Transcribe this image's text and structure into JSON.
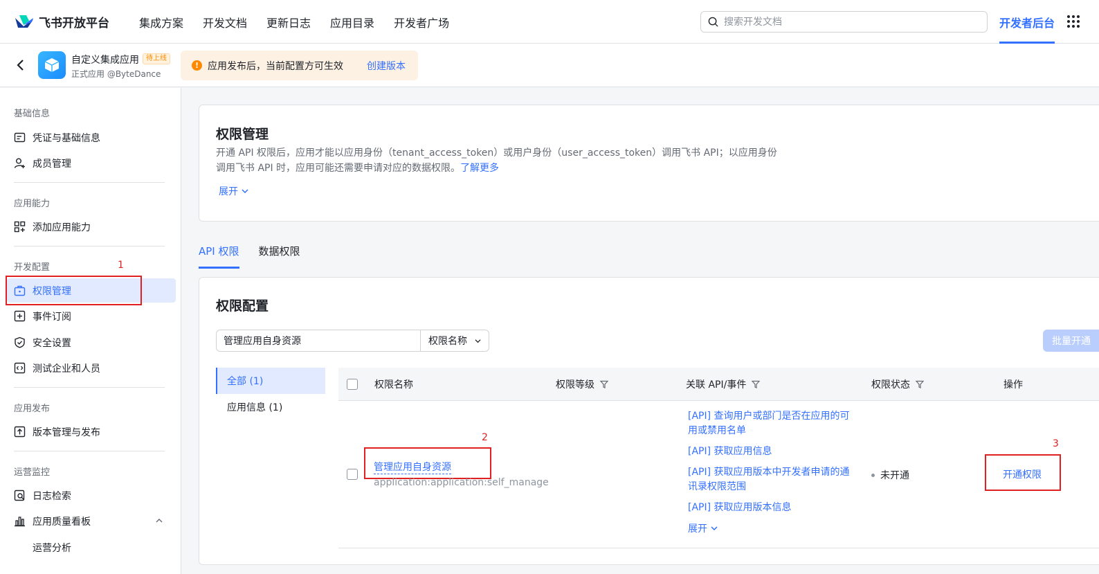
{
  "brand": {
    "name": "飞书开放平台"
  },
  "nav": {
    "items": [
      "集成方案",
      "开发文档",
      "更新日志",
      "应用目录",
      "开发者广场"
    ],
    "dev_console": "开发者后台"
  },
  "search": {
    "placeholder": "搜索开发文档"
  },
  "app": {
    "name": "自定义集成应用",
    "badge": "待上线",
    "subtitle": "正式应用 @ByteDance"
  },
  "notice": {
    "text": "应用发布后，当前配置方可生效",
    "link": "创建版本"
  },
  "sidebar": {
    "sections": [
      {
        "title": "基础信息",
        "items": [
          "凭证与基础信息",
          "成员管理"
        ]
      },
      {
        "title": "应用能力",
        "items": [
          "添加应用能力"
        ]
      },
      {
        "title": "开发配置",
        "items": [
          "权限管理",
          "事件订阅",
          "安全设置",
          "测试企业和人员"
        ]
      },
      {
        "title": "应用发布",
        "items": [
          "版本管理与发布"
        ]
      },
      {
        "title": "运营监控",
        "items": [
          "日志检索",
          "应用质量看板",
          "运营分析"
        ]
      }
    ]
  },
  "annotations": [
    "1",
    "2",
    "3"
  ],
  "intro": {
    "title": "权限管理",
    "desc_line1": "开通 API 权限后，应用才能以应用身份（tenant_access_token）或用户身份（user_access_token）调用飞书 API；以应用身份",
    "desc_line2": "调用飞书 API 时，应用可能还需要申请对应的数据权限。",
    "learn_more": "了解更多",
    "expand": "展开"
  },
  "tabs": [
    "API 权限",
    "数据权限"
  ],
  "config": {
    "title": "权限配置",
    "filter_value": "管理应用自身资源",
    "filter_select": "权限名称",
    "bulk_button": "批量开通",
    "categories": [
      "全部 (1)",
      "应用信息 (1)"
    ],
    "columns": [
      "权限名称",
      "权限等级",
      "关联 API/事件",
      "权限状态",
      "操作"
    ],
    "rows": [
      {
        "name": "管理应用自身资源",
        "scope": "application:application:self_manage",
        "apis": [
          "[API] 查询用户或部门是否在应用的可",
          "用或禁用名单",
          "[API] 获取应用信息",
          "[API] 获取应用版本中开发者申请的通",
          "讯录权限范围",
          "[API] 获取应用版本信息"
        ],
        "apis_expand": "展开",
        "status": "未开通",
        "action": "开通权限"
      }
    ]
  },
  "colors": {
    "accent": "#3370ff",
    "annotation": "#e02020",
    "warning": "#ff8800"
  }
}
